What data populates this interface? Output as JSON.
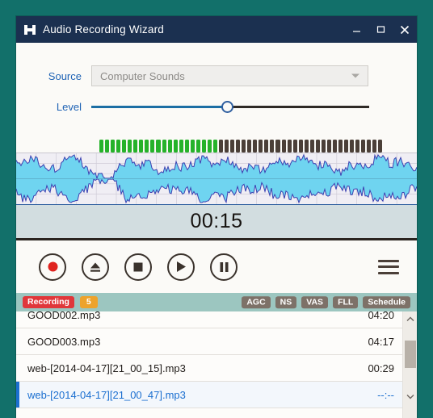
{
  "window": {
    "title": "Audio Recording Wizard",
    "icon": "app-icon",
    "minimize_label": "Minimize",
    "maximize_label": "Maximize",
    "close_label": "Close"
  },
  "controls": {
    "source_label": "Source",
    "source_value": "Computer Sounds",
    "source_placeholder": "Computer Sounds",
    "level_label": "Level",
    "level_percent": 49,
    "vu": {
      "total_segments": 50,
      "lit_segments": 21,
      "on_color": "#25b22a",
      "off_color": "#4b3f38"
    }
  },
  "timer": {
    "value": "00:15"
  },
  "transport": {
    "record_label": "Record",
    "eject_label": "Eject",
    "stop_label": "Stop",
    "play_label": "Play",
    "pause_label": "Pause",
    "menu_label": "Menu",
    "record_color": "#e0231f"
  },
  "status": {
    "state_badge": "Recording",
    "count_badge": "5",
    "options": [
      "AGC",
      "NS",
      "VAS",
      "FLL",
      "Schedule"
    ],
    "state_color": "#e0373a",
    "count_color": "#eda32c",
    "bar_color": "#9cc6c0"
  },
  "filelist": {
    "rows": [
      {
        "name": "GOOD002.mp3",
        "duration": "04:20",
        "selected": false
      },
      {
        "name": "GOOD003.mp3",
        "duration": "04:17",
        "selected": false
      },
      {
        "name": "web-[2014-04-17][21_00_15].mp3",
        "duration": "00:29",
        "selected": false
      },
      {
        "name": "web-[2014-04-17][21_00_47].mp3",
        "duration": "--:--",
        "selected": true
      }
    ],
    "scroll_up": "Scroll up",
    "scroll_down": "Scroll down"
  },
  "theme": {
    "desktop": "#12706a",
    "titlebar": "#1b3050",
    "accent": "#1f63b5"
  }
}
